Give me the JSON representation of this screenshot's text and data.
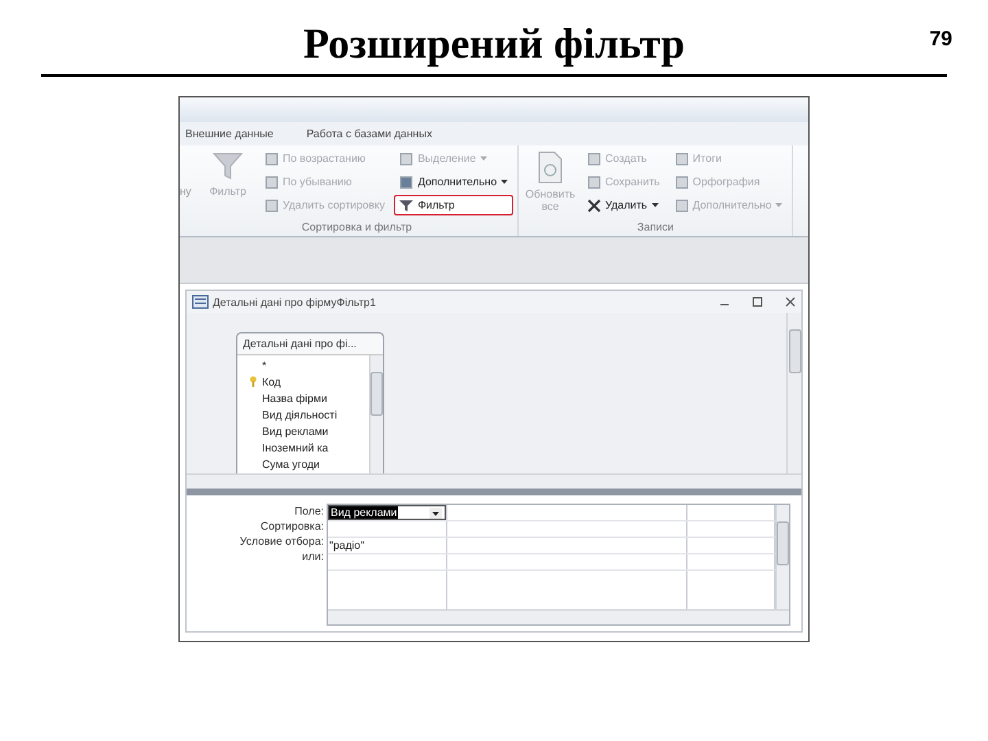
{
  "slide": {
    "title": "Розширений фільтр",
    "page_number": "79"
  },
  "ribbon": {
    "tabs": [
      "Внешние данные",
      "Работа с базами данных"
    ],
    "cut_label": "ну",
    "groups": [
      {
        "label": "Сортировка и фильтр",
        "big_button": {
          "label": "Фильтр",
          "disabled": true
        },
        "columns": [
          [
            {
              "label": "По возрастанию",
              "disabled": true,
              "dropdown": false,
              "highlighted": false
            },
            {
              "label": "По убыванию",
              "disabled": true,
              "dropdown": false,
              "highlighted": false
            },
            {
              "label": "Удалить сортировку",
              "disabled": true,
              "dropdown": false,
              "highlighted": false
            }
          ],
          [
            {
              "label": "Выделение",
              "disabled": true,
              "dropdown": true,
              "highlighted": false
            },
            {
              "label": "Дополнительно",
              "disabled": false,
              "dropdown": true,
              "highlighted": false
            },
            {
              "label": "Фильтр",
              "disabled": false,
              "dropdown": false,
              "highlighted": true
            }
          ]
        ]
      },
      {
        "label": "Записи",
        "big_button": {
          "label": "Обновить все",
          "disabled": true
        },
        "columns": [
          [
            {
              "label": "Создать",
              "disabled": true,
              "dropdown": false,
              "highlighted": false
            },
            {
              "label": "Сохранить",
              "disabled": true,
              "dropdown": false,
              "highlighted": false
            },
            {
              "label": "Удалить",
              "disabled": false,
              "dropdown": true,
              "highlighted": false
            }
          ],
          [
            {
              "label": "Итоги",
              "disabled": true,
              "dropdown": false,
              "highlighted": false
            },
            {
              "label": "Орфография",
              "disabled": true,
              "dropdown": false,
              "highlighted": false
            },
            {
              "label": "Дополнительно",
              "disabled": true,
              "dropdown": true,
              "highlighted": false
            }
          ]
        ]
      }
    ]
  },
  "query_window": {
    "title": "Детальні дані про фірмуФільтр1",
    "field_list": {
      "title": "Детальні дані про фі...",
      "fields": [
        {
          "name": "*",
          "key": false
        },
        {
          "name": "Код",
          "key": true
        },
        {
          "name": "Назва фірми",
          "key": false
        },
        {
          "name": "Вид діяльності",
          "key": false
        },
        {
          "name": "Вид реклами",
          "key": false
        },
        {
          "name": "Іноземний ка",
          "key": false
        },
        {
          "name": "Сума угоди",
          "key": false
        }
      ]
    },
    "grid": {
      "row_labels": [
        "Поле:",
        "Сортировка:",
        "Условие отбора:",
        "или:"
      ],
      "rows": [
        [
          {
            "text": "Вид реклами",
            "selected": true,
            "dropdown": true
          },
          {
            "text": "",
            "selected": false,
            "dropdown": false
          },
          {
            "text": "",
            "selected": false,
            "dropdown": false
          }
        ],
        [
          {
            "text": "",
            "selected": false,
            "dropdown": false
          },
          {
            "text": "",
            "selected": false,
            "dropdown": false
          },
          {
            "text": "",
            "selected": false,
            "dropdown": false
          }
        ],
        [
          {
            "text": "\"радіо\"",
            "selected": false,
            "dropdown": false
          },
          {
            "text": "",
            "selected": false,
            "dropdown": false
          },
          {
            "text": "",
            "selected": false,
            "dropdown": false
          }
        ],
        [
          {
            "text": "",
            "selected": false,
            "dropdown": false
          },
          {
            "text": "",
            "selected": false,
            "dropdown": false
          },
          {
            "text": "",
            "selected": false,
            "dropdown": false
          }
        ]
      ]
    }
  }
}
